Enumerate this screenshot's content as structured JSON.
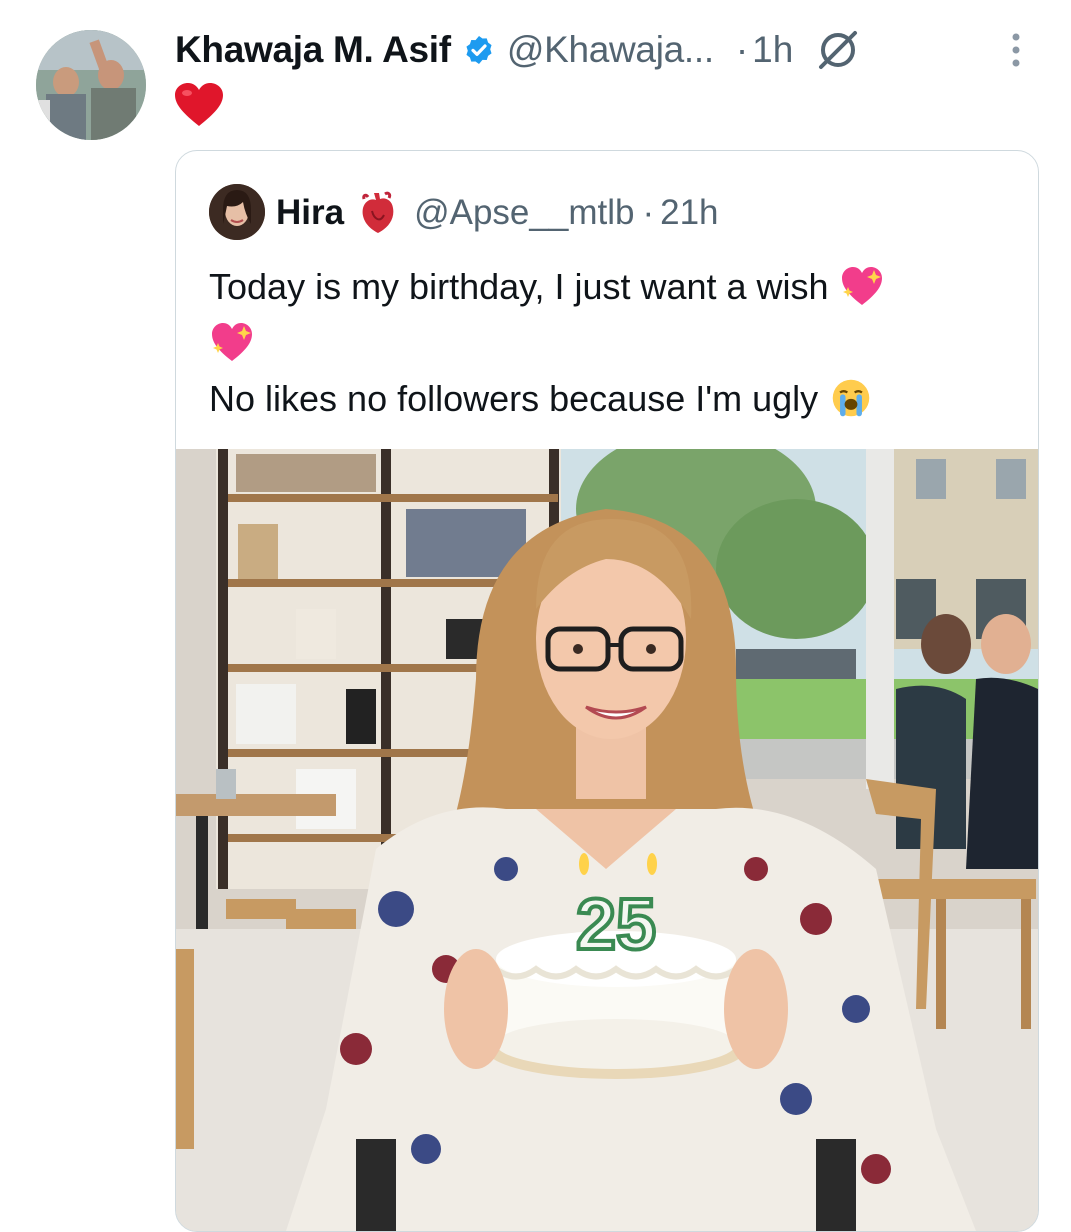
{
  "tweet": {
    "author_name": "Khawaja M. Asif",
    "author_handle": "@Khawaja...",
    "separator": "·",
    "time": "1h",
    "body_emoji": "red-heart",
    "icons": [
      "verified-badge-icon",
      "no-sign-icon",
      "more-options-icon"
    ]
  },
  "quoted_tweet": {
    "author_name": "Hira",
    "name_emoji": "anatomical-heart",
    "author_handle": "@Apse__mtlb",
    "separator": "·",
    "time": "21h",
    "line1": "Today is my birthday, I just want a wish",
    "line2": "No likes no followers because I'm ugly",
    "emojis": [
      "sparkling-heart",
      "sparkling-heart",
      "loudly-crying-face"
    ],
    "image": {
      "description_icon": "birthday-photo",
      "candle_number": "25"
    }
  },
  "colors": {
    "text_primary": "#0f1419",
    "text_secondary": "#536471",
    "verified_blue": "#1d9bf0",
    "border": "#cfd9de"
  }
}
